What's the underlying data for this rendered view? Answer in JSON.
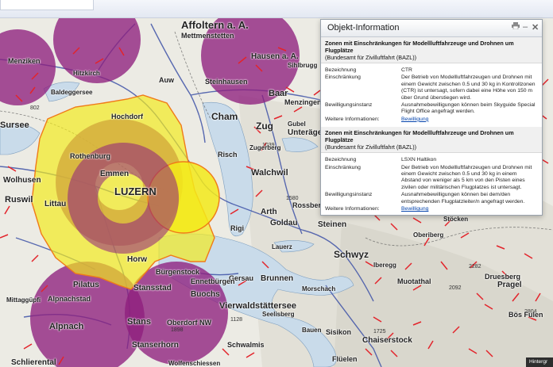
{
  "popup": {
    "title": "Objekt-Information",
    "print_icon": "print-icon",
    "minimize_symbol": "–",
    "close_symbol": "✕",
    "sections": [
      {
        "heading": "Zonen mit Einschränkungen für Modellluftfahrzeuge und Drohnen um Flugplätze",
        "source": "(Bundesamt für Zivilluftfahrt (BAZL))",
        "rows": [
          {
            "key": "Bezeichnung",
            "value": "CTR"
          },
          {
            "key": "Einschränkung",
            "value": "Der Betrieb von Modellluftfahrzeugen und Drohnen mit einem Gewicht zwischen 0.5 und 30 kg in Kontrollzonen (CTR) ist untersagt, sofern dabei eine Höhe von 150 m über Grund überstiegen wird."
          },
          {
            "key": "Bewilligungsinstanz",
            "value": "Ausnahmebewilligungen können beim Skyguide Special Flight Office angefragt werden."
          },
          {
            "key": "Weitere Informationen:",
            "link": "Bewilligung"
          }
        ]
      },
      {
        "heading": "Zonen mit Einschränkungen für Modellluftfahrzeuge und Drohnen um Flugplätze",
        "source": "(Bundesamt für Zivilluftfahrt (BAZL))",
        "rows": [
          {
            "key": "Bezeichnung",
            "value": "LSXN Haltikon"
          },
          {
            "key": "Einschränkung",
            "value": "Der Betrieb von Modellluftfahrzeugen und Drohnen mit einem Gewicht zwischen 0.5 und 30 kg in einem Abstand von weniger als 5 km von den Pisten eines zivilen oder militärischen Flugplatzes ist untersagt."
          },
          {
            "key": "Bewilligungsinstanz",
            "value": "Ausnahmebewilligungen können bei dem/den entsprechenden Flugplatzleiter/n angefragt werden."
          },
          {
            "key": "Weitere Informationen:",
            "link": "Bewilligung"
          }
        ]
      }
    ]
  },
  "map": {
    "zone_colors": {
      "purple": "#8e1f7e",
      "yellow": "#f3ea1a",
      "zone_border": "#f07a18",
      "lake": "#c9dbea",
      "road": "#3f53a8",
      "restriction": "#e3242b"
    },
    "places": [
      {
        "name": "Affoltern a. A.",
        "size": 13
      },
      {
        "name": "Mettmenstetten",
        "size": 9
      },
      {
        "name": "Auw",
        "size": 9
      },
      {
        "name": "Menziken",
        "size": 9
      },
      {
        "name": "Hitzkirch",
        "size": 8
      },
      {
        "name": "Baldeggersee",
        "size": 8
      },
      {
        "name": "Sursee",
        "size": 11
      },
      {
        "name": "Hochdorf",
        "size": 9
      },
      {
        "name": "Cham",
        "size": 12
      },
      {
        "name": "Zug",
        "size": 12
      },
      {
        "name": "Baar",
        "size": 11
      },
      {
        "name": "Menzingen",
        "size": 9
      },
      {
        "name": "Unterägeri",
        "size": 10
      },
      {
        "name": "Hausen a. A.",
        "size": 10
      },
      {
        "name": "Steinhausen",
        "size": 9
      },
      {
        "name": "Sihlbrugg",
        "size": 8
      },
      {
        "name": "Gubel",
        "size": 8
      },
      {
        "name": "Risch",
        "size": 9
      },
      {
        "name": "Zugerberg",
        "size": 8
      },
      {
        "name": "Walchwil",
        "size": 11
      },
      {
        "name": "Emmen",
        "size": 10
      },
      {
        "name": "Rothenburg",
        "size": 9
      },
      {
        "name": "LUZERN",
        "size": 13
      },
      {
        "name": "Littau",
        "size": 10
      },
      {
        "name": "Ruswil",
        "size": 11
      },
      {
        "name": "Wolhusen",
        "size": 10
      },
      {
        "name": "Arth",
        "size": 10
      },
      {
        "name": "Goldau",
        "size": 10
      },
      {
        "name": "Rossberg",
        "size": 9
      },
      {
        "name": "Rigi",
        "size": 9
      },
      {
        "name": "Lauerz",
        "size": 8
      },
      {
        "name": "Steinen",
        "size": 10
      },
      {
        "name": "Schwyz",
        "size": 12
      },
      {
        "name": "Oberiberg",
        "size": 8
      },
      {
        "name": "Iberegg",
        "size": 8
      },
      {
        "name": "Stöcken",
        "size": 8
      },
      {
        "name": "Druesberg",
        "size": 9
      },
      {
        "name": "Pragel",
        "size": 10
      },
      {
        "name": "Muotathal",
        "size": 9
      },
      {
        "name": "Bös Fulen",
        "size": 9
      },
      {
        "name": "Gersau",
        "size": 9
      },
      {
        "name": "Brunnen",
        "size": 10
      },
      {
        "name": "Morschach",
        "size": 8
      },
      {
        "name": "Sisikon",
        "size": 9
      },
      {
        "name": "Seelisberg",
        "size": 8
      },
      {
        "name": "Bauen",
        "size": 8
      },
      {
        "name": "Flüelen",
        "size": 9
      },
      {
        "name": "Chaiserstock",
        "size": 10
      },
      {
        "name": "Schwalmis",
        "size": 9
      },
      {
        "name": "Horw",
        "size": 10
      },
      {
        "name": "Stansstad",
        "size": 10
      },
      {
        "name": "Stans",
        "size": 11
      },
      {
        "name": "Buochs",
        "size": 10
      },
      {
        "name": "Ennetbürgen",
        "size": 9
      },
      {
        "name": "Oberdorf NW",
        "size": 9
      },
      {
        "name": "Pilatus",
        "size": 10
      },
      {
        "name": "Stanserhorn",
        "size": 10
      },
      {
        "name": "Alpnachstad",
        "size": 9
      },
      {
        "name": "Alpnach",
        "size": 11
      },
      {
        "name": "Mittaggüpfi",
        "size": 8
      },
      {
        "name": "Schlierental",
        "size": 10
      },
      {
        "name": "Bürgenstock",
        "size": 9
      },
      {
        "name": "Wolfenschiessen",
        "size": 8
      },
      {
        "name": "Vierwaldstättersee",
        "size": 11
      }
    ],
    "hint_label": "Hintergr"
  }
}
